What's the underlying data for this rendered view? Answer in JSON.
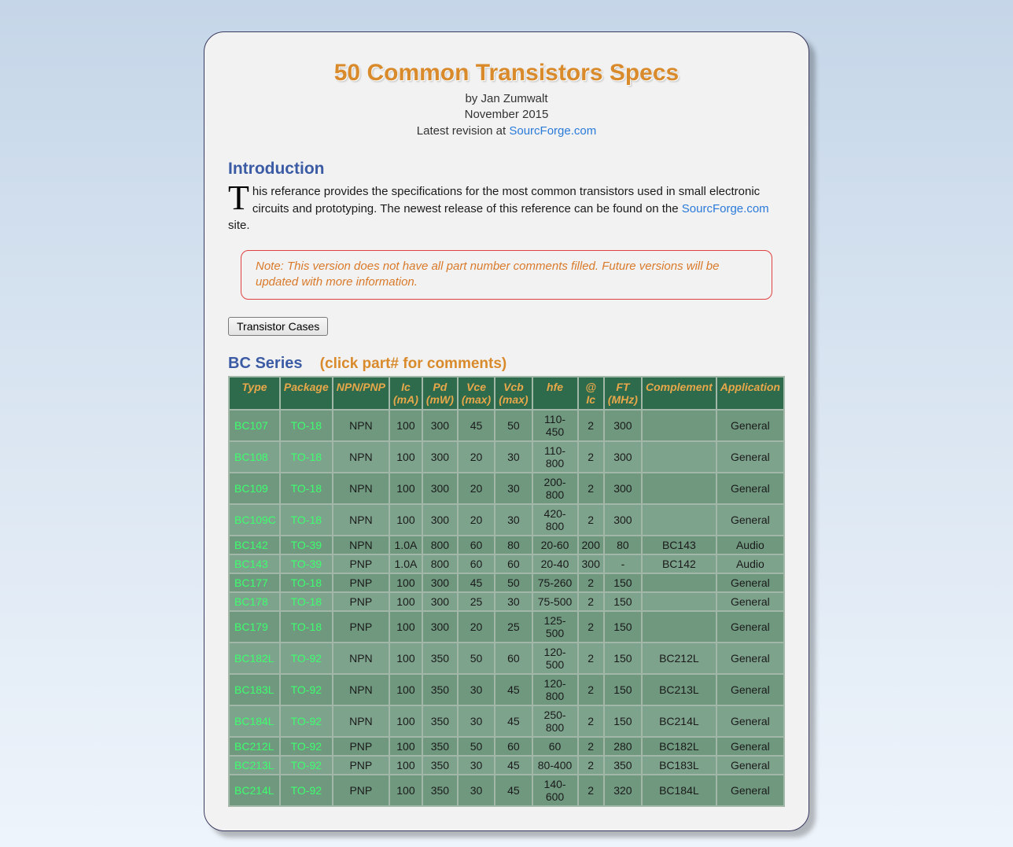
{
  "header": {
    "title": "50 Common Transistors Specs",
    "author": "by Jan Zumwalt",
    "date": "November 2015",
    "revision_prefix": "Latest revision at ",
    "revision_link": "SourcForge.com"
  },
  "intro": {
    "heading": "Introduction",
    "dropcap": "T",
    "text_before_link": "his referance provides the specifications for the most common transistors used in small electronic circuits and prototyping. The newest release of this reference can be found on the ",
    "link_text": "SourcForge.com",
    "text_after_link": " site."
  },
  "note": "Note: This version does not have all part number comments filled. Future versions will be updated with more information.",
  "button_cases": "Transistor Cases",
  "series": {
    "name": "BC Series",
    "hint": "(click part# for comments)"
  },
  "columns": [
    "Type",
    "Package",
    "NPN/PNP",
    "Ic (mA)",
    "Pd (mW)",
    "Vce (max)",
    "Vcb (max)",
    "hfe",
    "@ Ic",
    "FT (MHz)",
    "Complement",
    "Application"
  ],
  "rows": [
    {
      "type": "BC107",
      "pkg": "TO-18",
      "np": "NPN",
      "ic": "100",
      "pd": "300",
      "vce": "45",
      "vcb": "50",
      "hfe": "110-450",
      "aic": "2",
      "ft": "300",
      "comp": "",
      "app": "General"
    },
    {
      "type": "BC108",
      "pkg": "TO-18",
      "np": "NPN",
      "ic": "100",
      "pd": "300",
      "vce": "20",
      "vcb": "30",
      "hfe": "110-800",
      "aic": "2",
      "ft": "300",
      "comp": "",
      "app": "General"
    },
    {
      "type": "BC109",
      "pkg": "TO-18",
      "np": "NPN",
      "ic": "100",
      "pd": "300",
      "vce": "20",
      "vcb": "30",
      "hfe": "200-800",
      "aic": "2",
      "ft": "300",
      "comp": "",
      "app": "General"
    },
    {
      "type": "BC109C",
      "pkg": "TO-18",
      "np": "NPN",
      "ic": "100",
      "pd": "300",
      "vce": "20",
      "vcb": "30",
      "hfe": "420-800",
      "aic": "2",
      "ft": "300",
      "comp": "",
      "app": "General"
    },
    {
      "type": "BC142",
      "pkg": "TO-39",
      "np": "NPN",
      "ic": "1.0A",
      "pd": "800",
      "vce": "60",
      "vcb": "80",
      "hfe": "20-60",
      "aic": "200",
      "ft": "80",
      "comp": "BC143",
      "app": "Audio"
    },
    {
      "type": "BC143",
      "pkg": "TO-39",
      "np": "PNP",
      "ic": "1.0A",
      "pd": "800",
      "vce": "60",
      "vcb": "60",
      "hfe": "20-40",
      "aic": "300",
      "ft": "-",
      "comp": "BC142",
      "app": "Audio"
    },
    {
      "type": "BC177",
      "pkg": "TO-18",
      "np": "PNP",
      "ic": "100",
      "pd": "300",
      "vce": "45",
      "vcb": "50",
      "hfe": "75-260",
      "aic": "2",
      "ft": "150",
      "comp": "",
      "app": "General"
    },
    {
      "type": "BC178",
      "pkg": "TO-18",
      "np": "PNP",
      "ic": "100",
      "pd": "300",
      "vce": "25",
      "vcb": "30",
      "hfe": "75-500",
      "aic": "2",
      "ft": "150",
      "comp": "",
      "app": "General"
    },
    {
      "type": "BC179",
      "pkg": "TO-18",
      "np": "PNP",
      "ic": "100",
      "pd": "300",
      "vce": "20",
      "vcb": "25",
      "hfe": "125-500",
      "aic": "2",
      "ft": "150",
      "comp": "",
      "app": "General"
    },
    {
      "type": "BC182L",
      "pkg": "TO-92",
      "np": "NPN",
      "ic": "100",
      "pd": "350",
      "vce": "50",
      "vcb": "60",
      "hfe": "120-500",
      "aic": "2",
      "ft": "150",
      "comp": "BC212L",
      "app": "General"
    },
    {
      "type": "BC183L",
      "pkg": "TO-92",
      "np": "NPN",
      "ic": "100",
      "pd": "350",
      "vce": "30",
      "vcb": "45",
      "hfe": "120-800",
      "aic": "2",
      "ft": "150",
      "comp": "BC213L",
      "app": "General"
    },
    {
      "type": "BC184L",
      "pkg": "TO-92",
      "np": "NPN",
      "ic": "100",
      "pd": "350",
      "vce": "30",
      "vcb": "45",
      "hfe": "250-800",
      "aic": "2",
      "ft": "150",
      "comp": "BC214L",
      "app": "General"
    },
    {
      "type": "BC212L",
      "pkg": "TO-92",
      "np": "PNP",
      "ic": "100",
      "pd": "350",
      "vce": "50",
      "vcb": "60",
      "hfe": "60",
      "aic": "2",
      "ft": "280",
      "comp": "BC182L",
      "app": "General"
    },
    {
      "type": "BC213L",
      "pkg": "TO-92",
      "np": "PNP",
      "ic": "100",
      "pd": "350",
      "vce": "30",
      "vcb": "45",
      "hfe": "80-400",
      "aic": "2",
      "ft": "350",
      "comp": "BC183L",
      "app": "General"
    },
    {
      "type": "BC214L",
      "pkg": "TO-92",
      "np": "PNP",
      "ic": "100",
      "pd": "350",
      "vce": "30",
      "vcb": "45",
      "hfe": "140-600",
      "aic": "2",
      "ft": "320",
      "comp": "BC184L",
      "app": "General"
    }
  ],
  "chart_data": {
    "type": "table",
    "title": "BC Series Transistor Specifications",
    "columns": [
      "Type",
      "Package",
      "NPN/PNP",
      "Ic (mA)",
      "Pd (mW)",
      "Vce (max)",
      "Vcb (max)",
      "hfe",
      "@ Ic",
      "FT (MHz)",
      "Complement",
      "Application"
    ],
    "rows": [
      [
        "BC107",
        "TO-18",
        "NPN",
        "100",
        "300",
        "45",
        "50",
        "110-450",
        "2",
        "300",
        "",
        "General"
      ],
      [
        "BC108",
        "TO-18",
        "NPN",
        "100",
        "300",
        "20",
        "30",
        "110-800",
        "2",
        "300",
        "",
        "General"
      ],
      [
        "BC109",
        "TO-18",
        "NPN",
        "100",
        "300",
        "20",
        "30",
        "200-800",
        "2",
        "300",
        "",
        "General"
      ],
      [
        "BC109C",
        "TO-18",
        "NPN",
        "100",
        "300",
        "20",
        "30",
        "420-800",
        "2",
        "300",
        "",
        "General"
      ],
      [
        "BC142",
        "TO-39",
        "NPN",
        "1.0A",
        "800",
        "60",
        "80",
        "20-60",
        "200",
        "80",
        "BC143",
        "Audio"
      ],
      [
        "BC143",
        "TO-39",
        "PNP",
        "1.0A",
        "800",
        "60",
        "60",
        "20-40",
        "300",
        "-",
        "BC142",
        "Audio"
      ],
      [
        "BC177",
        "TO-18",
        "PNP",
        "100",
        "300",
        "45",
        "50",
        "75-260",
        "2",
        "150",
        "",
        "General"
      ],
      [
        "BC178",
        "TO-18",
        "PNP",
        "100",
        "300",
        "25",
        "30",
        "75-500",
        "2",
        "150",
        "",
        "General"
      ],
      [
        "BC179",
        "TO-18",
        "PNP",
        "100",
        "300",
        "20",
        "25",
        "125-500",
        "2",
        "150",
        "",
        "General"
      ],
      [
        "BC182L",
        "TO-92",
        "NPN",
        "100",
        "350",
        "50",
        "60",
        "120-500",
        "2",
        "150",
        "BC212L",
        "General"
      ],
      [
        "BC183L",
        "TO-92",
        "NPN",
        "100",
        "350",
        "30",
        "45",
        "120-800",
        "2",
        "150",
        "BC213L",
        "General"
      ],
      [
        "BC184L",
        "TO-92",
        "NPN",
        "100",
        "350",
        "30",
        "45",
        "250-800",
        "2",
        "150",
        "BC214L",
        "General"
      ],
      [
        "BC212L",
        "TO-92",
        "PNP",
        "100",
        "350",
        "50",
        "60",
        "60",
        "2",
        "280",
        "BC182L",
        "General"
      ],
      [
        "BC213L",
        "TO-92",
        "PNP",
        "100",
        "350",
        "30",
        "45",
        "80-400",
        "2",
        "350",
        "BC183L",
        "General"
      ],
      [
        "BC214L",
        "TO-92",
        "PNP",
        "100",
        "350",
        "30",
        "45",
        "140-600",
        "2",
        "320",
        "BC184L",
        "General"
      ]
    ]
  }
}
